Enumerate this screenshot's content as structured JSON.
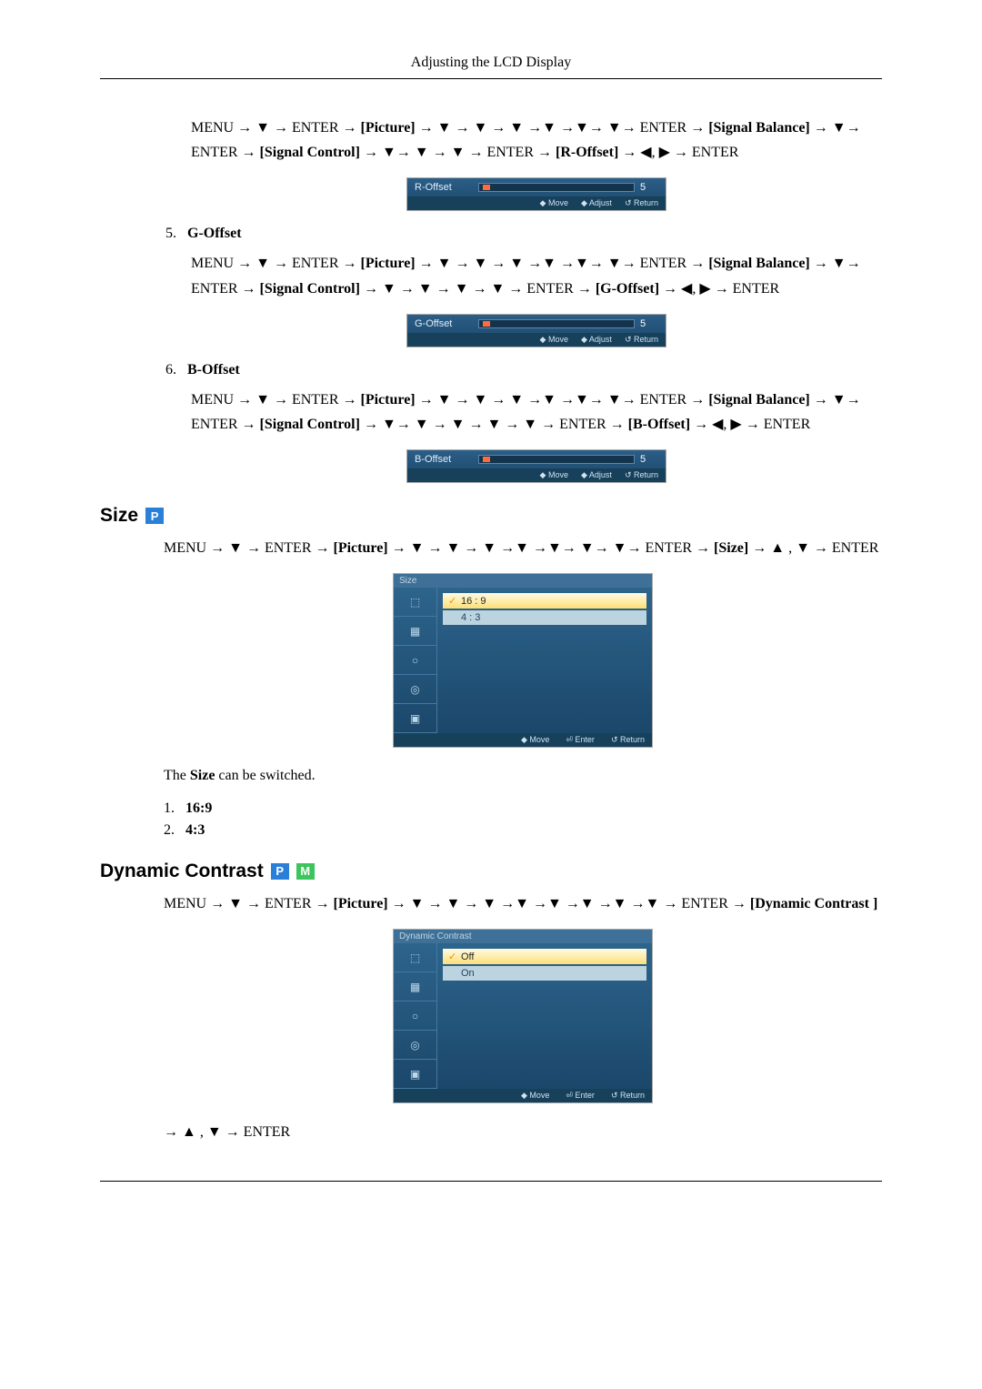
{
  "header": {
    "title": "Adjusting the LCD Display"
  },
  "roffset": {
    "path_html": "MENU → ▼ → ENTER → <b>[Picture]</b> → ▼ → ▼ → ▼ →▼ →▼→ ▼→ ENTER → <b>[Signal Balance]</b> → ▼→ ENTER → <b>[Signal Control]</b> → ▼→ ▼ → ▼ → ENTER → <b>[R-Offset]</b> → ◀, ▶ → ENTER",
    "slider": {
      "label": "R-Offset",
      "value": "5",
      "footer": [
        "◆ Move",
        "◆ Adjust",
        "↺ Return"
      ]
    }
  },
  "goffset": {
    "num": "5.",
    "title": "G-Offset",
    "path_html": "MENU → ▼ → ENTER → <b>[Picture]</b> → ▼ → ▼ → ▼ →▼ →▼→ ▼→ ENTER → <b>[Signal Balance]</b> → ▼→ ENTER → <b>[Signal Control]</b> → ▼ → ▼ → ▼ → ▼ → ENTER → <b>[G-Offset]</b> → ◀, ▶ → ENTER",
    "slider": {
      "label": "G-Offset",
      "value": "5",
      "footer": [
        "◆ Move",
        "◆ Adjust",
        "↺ Return"
      ]
    }
  },
  "boffset": {
    "num": "6.",
    "title": "B-Offset",
    "path_html": "MENU → ▼ → ENTER → <b>[Picture]</b> → ▼ → ▼ → ▼ →▼ →▼→ ▼→ ENTER → <b>[Signal Balance]</b> → ▼→ ENTER → <b>[Signal Control]</b> → ▼→ ▼ → ▼ → ▼ → ▼ → ENTER → <b>[B-Offset]</b> → ◀, ▶ → ENTER",
    "slider": {
      "label": "B-Offset",
      "value": "5",
      "footer": [
        "◆ Move",
        "◆ Adjust",
        "↺ Return"
      ]
    }
  },
  "size": {
    "heading": "Size",
    "badges": [
      "P"
    ],
    "path_html": "MENU → ▼ → ENTER → <b>[Picture]</b> → ▼ → ▼ → ▼ →▼ →▼→ ▼→ ▼→ ENTER → <b>[Size]</b> → ▲ , ▼ → ENTER",
    "menu": {
      "title": "Size",
      "options": [
        {
          "label": "16 : 9",
          "selected": true
        },
        {
          "label": "4 : 3",
          "selected": false
        }
      ],
      "footer": [
        "◆ Move",
        "⏎ Enter",
        "↺ Return"
      ]
    },
    "body_html": "The <b>Size</b> can be switched.",
    "list": [
      {
        "n": "1.",
        "t": "16:9"
      },
      {
        "n": "2.",
        "t": "4:3"
      }
    ]
  },
  "dyncontrast": {
    "heading": "Dynamic Contrast",
    "badges": [
      "P",
      "M"
    ],
    "path_html": "MENU → ▼ → ENTER → <b>[Picture]</b> → ▼ → ▼ → ▼ →▼ →▼ →▼ →▼ →▼ → ENTER → <b>[Dynamic Contrast ]</b>",
    "menu": {
      "title": "Dynamic Contrast",
      "options": [
        {
          "label": "Off",
          "selected": true
        },
        {
          "label": "On",
          "selected": false
        }
      ],
      "footer": [
        "◆ Move",
        "⏎ Enter",
        "↺ Return"
      ]
    },
    "suffix": "→ ▲ , ▼ → ENTER"
  }
}
